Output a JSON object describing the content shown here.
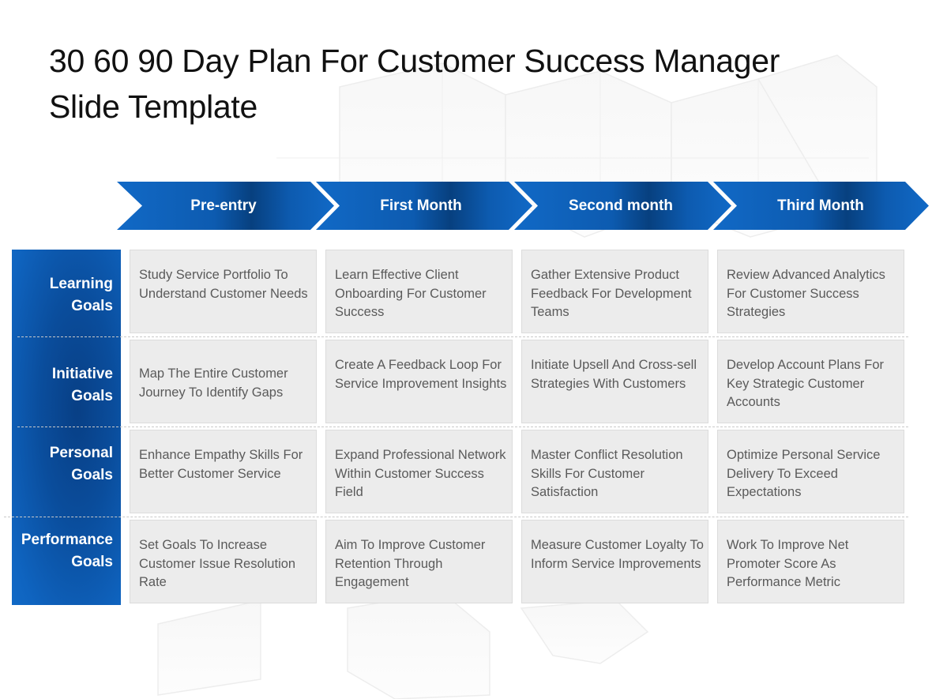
{
  "slide": {
    "title_line1": "30 60 90 Day Plan For Customer Success Manager",
    "title_line2": "Slide Template"
  },
  "colors": {
    "accent_blue": "#0f64c0",
    "accent_blue_dark": "#083f85",
    "cell_bg": "#ececec",
    "cell_text": "#5a5a5a"
  },
  "phases": [
    {
      "label": "Pre-entry"
    },
    {
      "label": "First Month"
    },
    {
      "label": "Second month"
    },
    {
      "label": "Third Month"
    }
  ],
  "rows": [
    {
      "label_line1": "Learning",
      "label_line2": "Goals",
      "cells": [
        "Study Service Portfolio To Understand Customer Needs",
        "Learn Effective Client Onboarding For Customer Success",
        "Gather Extensive Product Feedback For Development Teams",
        "Review Advanced Analytics For Customer Success Strategies"
      ]
    },
    {
      "label_line1": "Initiative",
      "label_line2": "Goals",
      "cells": [
        "Map The Entire Customer Journey To Identify Gaps",
        "Create A Feedback Loop For Service Improvement Insights",
        "Initiate Upsell And Cross-sell Strategies With Customers",
        "Develop Account Plans For Key Strategic Customer Accounts"
      ]
    },
    {
      "label_line1": "Personal",
      "label_line2": "Goals",
      "cells": [
        "Enhance Empathy Skills For Better Customer Service",
        "Expand Professional Network Within Customer Success Field",
        "Master Conflict Resolution Skills For Customer Satisfaction",
        "Optimize Personal Service Delivery To Exceed Expectations"
      ]
    },
    {
      "label_line1": "Performance",
      "label_line2": "Goals",
      "cells": [
        "Set Goals To Increase Customer Issue Resolution Rate",
        "Aim To Improve Customer Retention Through Engagement",
        "Measure Customer Loyalty To Inform Service Improvements",
        "Work To Improve Net Promoter Score As Performance Metric"
      ]
    }
  ]
}
